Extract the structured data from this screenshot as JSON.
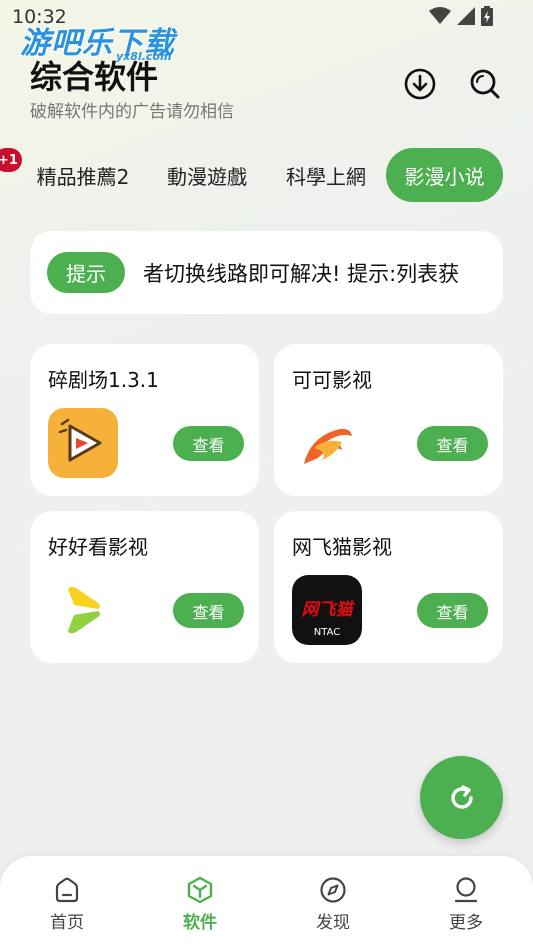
{
  "status": {
    "time": "10:32"
  },
  "watermark": {
    "main": "游吧乐下载",
    "sub": "yx8l.com"
  },
  "header": {
    "title": "综合软件",
    "subtitle": "破解软件内的广告请勿相信",
    "download_icon": "download-icon",
    "search_icon": "search-icon"
  },
  "tabs": {
    "badge": "+1",
    "items": [
      {
        "label": "精品推薦2"
      },
      {
        "label": "動漫遊戲"
      },
      {
        "label": "科學上網"
      },
      {
        "label": "影漫小说"
      }
    ],
    "active": 3
  },
  "notice": {
    "chip": "提示",
    "text": "者切换线路即可解决!   提示:列表获"
  },
  "apps": [
    {
      "name": "碎剧场1.3.1",
      "button": "查看",
      "icon": "film-play-icon",
      "color": "#f6b13a"
    },
    {
      "name": "可可影视",
      "button": "查看",
      "icon": "flame-logo-icon",
      "color": "#f0642a"
    },
    {
      "name": "好好看影视",
      "button": "查看",
      "icon": "play-leaf-icon",
      "color": "#f7d21e"
    },
    {
      "name": "网飞猫影视",
      "button": "查看",
      "icon": "ntac-logo-icon",
      "color": "#111111",
      "logo_text": "网飞猫",
      "logo_sub": "NTAC"
    }
  ],
  "fab": {
    "icon": "refresh-icon"
  },
  "nav": [
    {
      "label": "首页",
      "icon": "home-icon"
    },
    {
      "label": "软件",
      "icon": "box-icon"
    },
    {
      "label": "发现",
      "icon": "compass-icon"
    },
    {
      "label": "更多",
      "icon": "user-icon"
    }
  ],
  "colors": {
    "accent": "#4caf50",
    "badge": "#c8102e"
  }
}
